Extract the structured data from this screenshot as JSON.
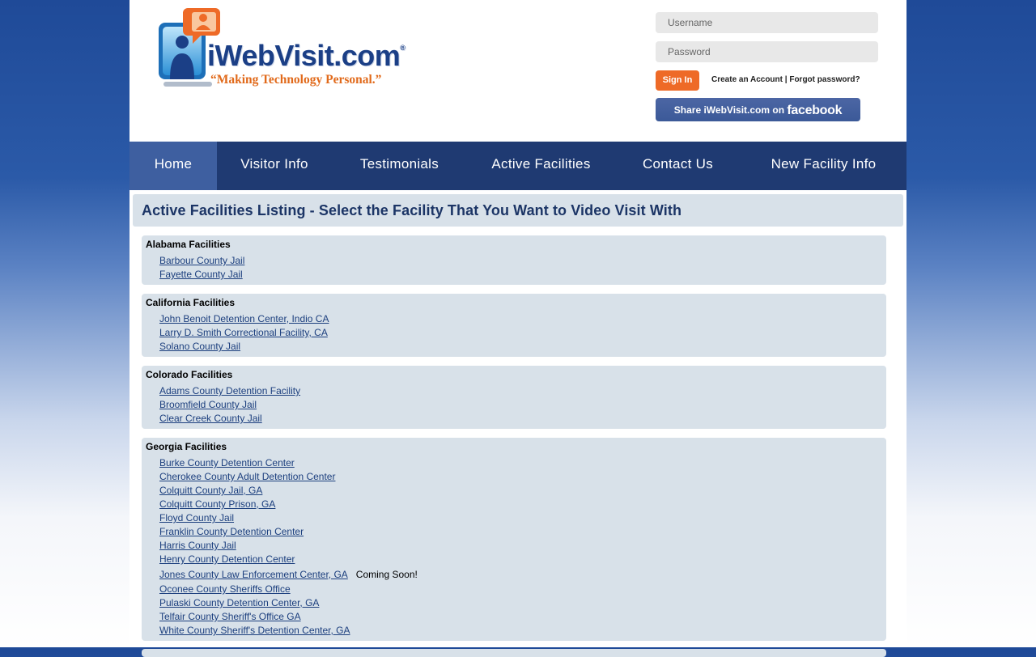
{
  "brand": {
    "name": "iWebVisit.com",
    "tagline": "“Making Technology Personal.”"
  },
  "login": {
    "username_placeholder": "Username",
    "password_placeholder": "Password",
    "signin_label": "Sign In",
    "create_account": "Create an Account",
    "separator": " | ",
    "forgot_password": "Forgot password?"
  },
  "share": {
    "prefix": "Share iWebVisit.com on ",
    "network": "facebook"
  },
  "nav": {
    "items": [
      {
        "label": "Home",
        "active": true
      },
      {
        "label": "Visitor Info"
      },
      {
        "label": "Testimonials"
      },
      {
        "label": "Active Facilities"
      },
      {
        "label": "Contact Us"
      },
      {
        "label": "New Facility Info"
      }
    ]
  },
  "main": {
    "title": "Active Facilities Listing - Select the Facility That You Want to Video Visit With",
    "states": [
      {
        "heading": "Alabama Facilities",
        "facilities": [
          "Barbour County Jail",
          "Fayette County Jail"
        ]
      },
      {
        "heading": "California Facilities",
        "facilities": [
          "John Benoit Detention Center, Indio CA",
          "Larry D. Smith Correctional Facility, CA",
          "Solano County Jail"
        ]
      },
      {
        "heading": "Colorado Facilities",
        "facilities": [
          "Adams County Detention Facility",
          "Broomfield County Jail",
          "Clear Creek County Jail"
        ]
      },
      {
        "heading": "Georgia Facilities",
        "facilities": [
          "Burke County Detention Center",
          "Cherokee County Adult Detention Center",
          "Colquitt County Jail, GA",
          "Colquitt County Prison, GA",
          "Floyd County Jail",
          "Franklin County Detention Center",
          "Harris County Jail",
          "Henry County Detention Center",
          "Jones County Law Enforcement Center, GA",
          "Oconee County Sheriffs Office",
          "Pulaski County Detention Center, GA",
          "Telfair County Sheriff's Office GA",
          "White County Sheriff's Detention Center, GA"
        ],
        "notes": {
          "8": "Coming Soon!"
        }
      }
    ]
  },
  "colors": {
    "nav_bg": "#1f3a72",
    "nav_active": "#3e5fa0",
    "panel_bg": "#d8e1e9",
    "link": "#1c3f7e",
    "signin": "#ee6a27",
    "facebook": "#3b5998"
  }
}
